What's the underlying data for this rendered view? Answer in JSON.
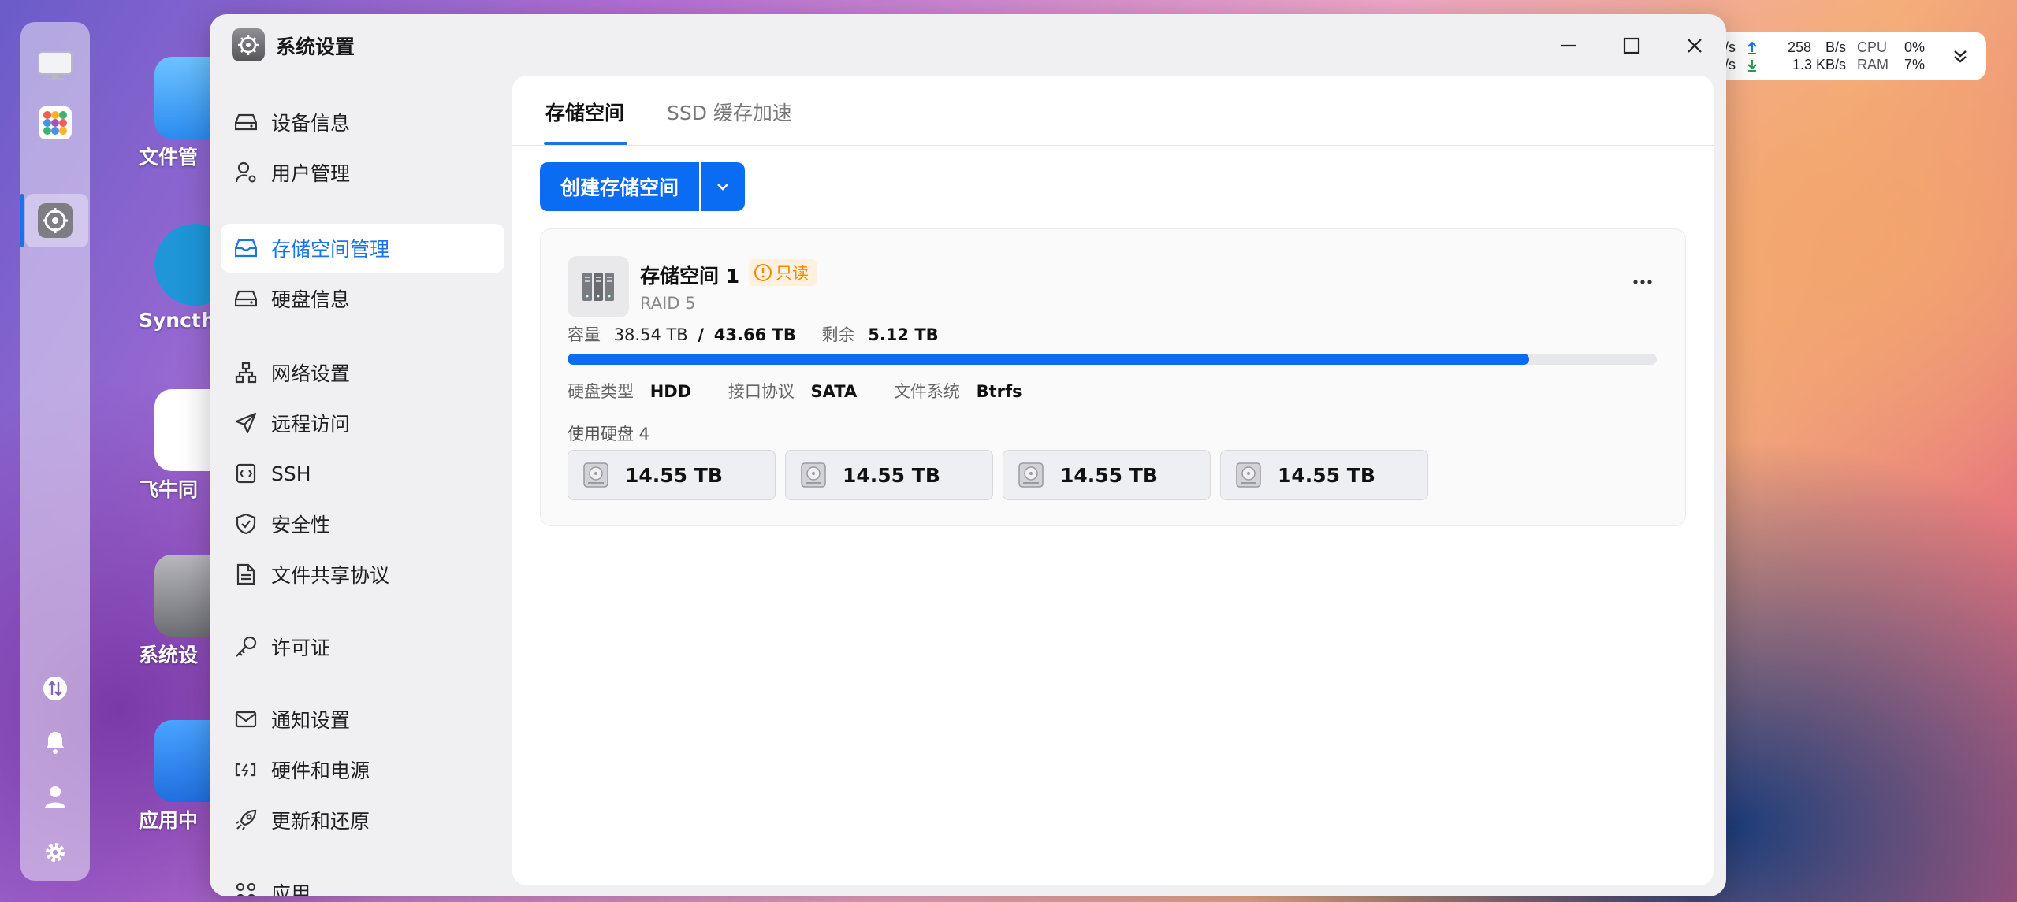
{
  "window": {
    "title": "系统设置"
  },
  "sidebar": {
    "items": [
      {
        "label": "设备信息",
        "icon": "hard-drive-icon"
      },
      {
        "label": "用户管理",
        "icon": "user-gear-icon"
      },
      {
        "label": "存储空间管理",
        "icon": "storage-icon",
        "active": true
      },
      {
        "label": "硬盘信息",
        "icon": "hard-drive-icon"
      },
      {
        "label": "网络设置",
        "icon": "network-icon"
      },
      {
        "label": "远程访问",
        "icon": "send-icon"
      },
      {
        "label": "SSH",
        "icon": "terminal-icon"
      },
      {
        "label": "安全性",
        "icon": "shield-icon"
      },
      {
        "label": "文件共享协议",
        "icon": "document-icon"
      },
      {
        "label": "许可证",
        "icon": "key-icon"
      },
      {
        "label": "通知设置",
        "icon": "mail-icon"
      },
      {
        "label": "硬件和电源",
        "icon": "battery-icon"
      },
      {
        "label": "更新和还原",
        "icon": "rocket-icon"
      },
      {
        "label": "应用",
        "icon": "apps-icon"
      }
    ]
  },
  "tabs": [
    {
      "label": "存储空间",
      "active": true
    },
    {
      "label": "SSD 缓存加速",
      "active": false
    }
  ],
  "toolbar": {
    "create_label": "创建存储空间"
  },
  "pool": {
    "name": "存储空间 1",
    "badge": "只读",
    "raid": "RAID 5",
    "capacity_label": "容量",
    "used": "38.54 TB",
    "separator": "/",
    "total": "43.66 TB",
    "free_label": "剩余",
    "free": "5.12 TB",
    "usage_fraction": 0.883,
    "disk_type_label": "硬盘类型",
    "disk_type": "HDD",
    "interface_label": "接口协议",
    "interface": "SATA",
    "fs_label": "文件系统",
    "fs": "Btrfs",
    "disks_label": "使用硬盘 4",
    "disks": [
      "14.55 TB",
      "14.55 TB",
      "14.55 TB",
      "14.55 TB"
    ]
  },
  "monitor": {
    "up_left": "/s",
    "down_left": "/s",
    "up_rate": "258",
    "up_unit": "B/s",
    "down_rate": "1.3 KB/s",
    "cpu_label": "CPU",
    "cpu_value": "0%",
    "ram_label": "RAM",
    "ram_value": "7%"
  },
  "desktop": {
    "labels": [
      "文件管",
      "Syncth",
      "飞牛同",
      "系统设",
      "应用中"
    ]
  },
  "colors": {
    "accent": "#0a6cf2",
    "badge_text": "#f08a00",
    "badge_bg": "#fff1de"
  }
}
